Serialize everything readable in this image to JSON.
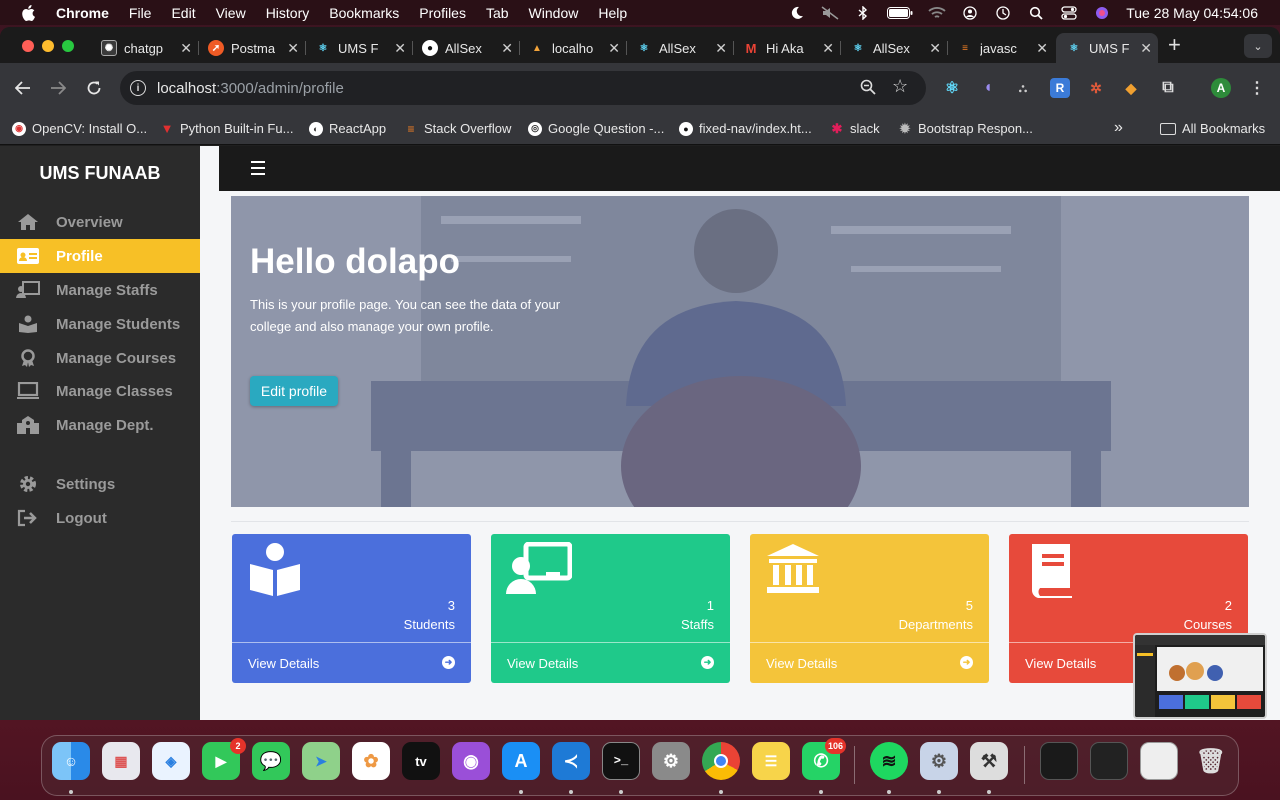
{
  "menubar": {
    "app_name": "Chrome",
    "menus": [
      "File",
      "Edit",
      "View",
      "History",
      "Bookmarks",
      "Profiles",
      "Tab",
      "Window",
      "Help"
    ],
    "clock": "Tue 28 May  04:54:06"
  },
  "tabs": [
    {
      "title": "chatgp",
      "icon": "chatgpt-icon",
      "color": "#3a3a3a"
    },
    {
      "title": "Postma",
      "icon": "postman-icon",
      "color": "#ef5b25"
    },
    {
      "title": "UMS F",
      "icon": "react-icon",
      "color": "#1b1b1b"
    },
    {
      "title": "AllSex",
      "icon": "github-icon",
      "color": "#1b1b1b"
    },
    {
      "title": "localho",
      "icon": "localhost-icon",
      "color": "#1b1b1b"
    },
    {
      "title": "AllSex",
      "icon": "react-icon",
      "color": "#1b1b1b"
    },
    {
      "title": "Hi Aka",
      "icon": "gmail-icon",
      "color": "#1b1b1b"
    },
    {
      "title": "AllSex",
      "icon": "react-icon",
      "color": "#1b1b1b"
    },
    {
      "title": "javasc",
      "icon": "stackoverflow-icon",
      "color": "#1b1b1b"
    },
    {
      "title": "UMS F",
      "icon": "react-icon",
      "color": "#1b1b1b",
      "active": true
    }
  ],
  "address_bar": {
    "host": "localhost",
    "path": ":3000/admin/profile"
  },
  "extensions": {
    "r_label": "R",
    "avatar_letter": "A"
  },
  "bookmarks": [
    "OpenCV: Install O...",
    "Python Built-in Fu...",
    "ReactApp",
    "Stack Overflow",
    "Google Question -...",
    "fixed-nav/index.ht...",
    "slack",
    "Bootstrap Respon..."
  ],
  "bookmarks_overflow": "»",
  "all_bookmarks": "All Bookmarks",
  "sidebar": {
    "brand": "UMS FUNAAB",
    "items": [
      {
        "label": "Overview",
        "icon": "home-icon"
      },
      {
        "label": "Profile",
        "icon": "id-card-icon",
        "active": true
      },
      {
        "label": "Manage Staffs",
        "icon": "chalkboard-teacher-icon"
      },
      {
        "label": "Manage Students",
        "icon": "student-icon"
      },
      {
        "label": "Manage Courses",
        "icon": "award-icon"
      },
      {
        "label": "Manage Classes",
        "icon": "monitor-icon"
      },
      {
        "label": "Manage Dept.",
        "icon": "school-icon"
      }
    ],
    "settings": "Settings",
    "logout": "Logout",
    "active_color": "#f7c026"
  },
  "hero": {
    "greeting": "Hello dolapo",
    "description": "This is your profile page. You can see the data of your college and also manage your own profile.",
    "edit_button": "Edit profile"
  },
  "stats": [
    {
      "value": "3",
      "label": "Students",
      "link": "View Details",
      "color": "#4b6fdc",
      "icon": "book-reader-icon"
    },
    {
      "value": "1",
      "label": "Staffs",
      "link": "View Details",
      "color": "#1fc98a",
      "icon": "chalkboard-teacher-icon"
    },
    {
      "value": "5",
      "label": "Departments",
      "link": "View Details",
      "color": "#f4c43a",
      "icon": "university-icon"
    },
    {
      "value": "2",
      "label": "Courses",
      "link": "View Details",
      "color": "#e74a3b",
      "icon": "book-icon"
    }
  ],
  "dock": {
    "facetime_badge": "2",
    "whatsapp_badge": "106",
    "appletv_label": "tv"
  }
}
